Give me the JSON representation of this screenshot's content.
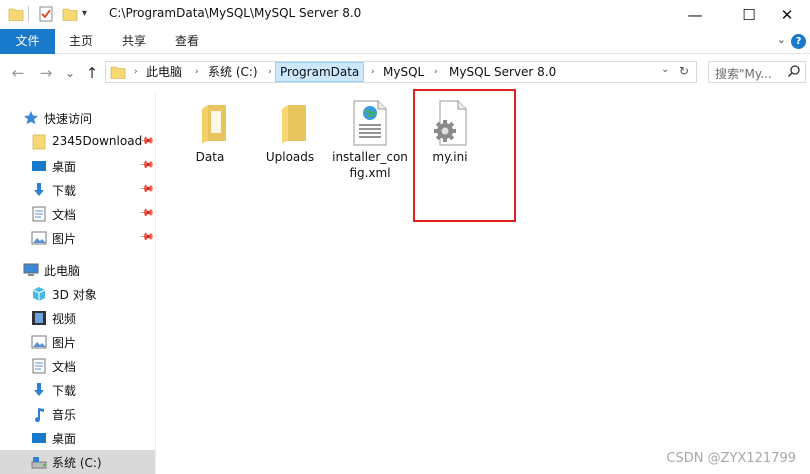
{
  "window": {
    "title": "C:\\ProgramData\\MySQL\\MySQL Server 8.0",
    "minimize": "—",
    "maximize": "☐",
    "close": "✕"
  },
  "ribbon": {
    "tabs": [
      "文件",
      "主页",
      "共享",
      "查看"
    ],
    "help": "?"
  },
  "nav": {
    "back": "←",
    "forward": "→",
    "recent": "⌄",
    "up": "↑",
    "breadcrumb": [
      "此电脑",
      "系统 (C:)",
      "ProgramData",
      "MySQL",
      "MySQL Server 8.0"
    ],
    "search_placeholder": "搜索\"My..."
  },
  "sidebar": {
    "quick_access": {
      "label": "快速访问",
      "items": [
        "2345Download",
        "桌面",
        "下载",
        "文档",
        "图片"
      ]
    },
    "this_pc": {
      "label": "此电脑",
      "items": [
        "3D 对象",
        "视频",
        "图片",
        "文档",
        "下载",
        "音乐",
        "桌面",
        "系统 (C:)"
      ]
    }
  },
  "files": [
    {
      "name": "Data",
      "type": "folder"
    },
    {
      "name": "Uploads",
      "type": "folder"
    },
    {
      "name": "installer_config.xml",
      "type": "xml"
    },
    {
      "name": "my.ini",
      "type": "ini"
    }
  ],
  "watermark": "CSDN @ZYX121799",
  "colors": {
    "accent": "#1979ca",
    "folder": "#f8d775",
    "highlight": "#e02020",
    "selected_crumb": "#cce8ff"
  }
}
